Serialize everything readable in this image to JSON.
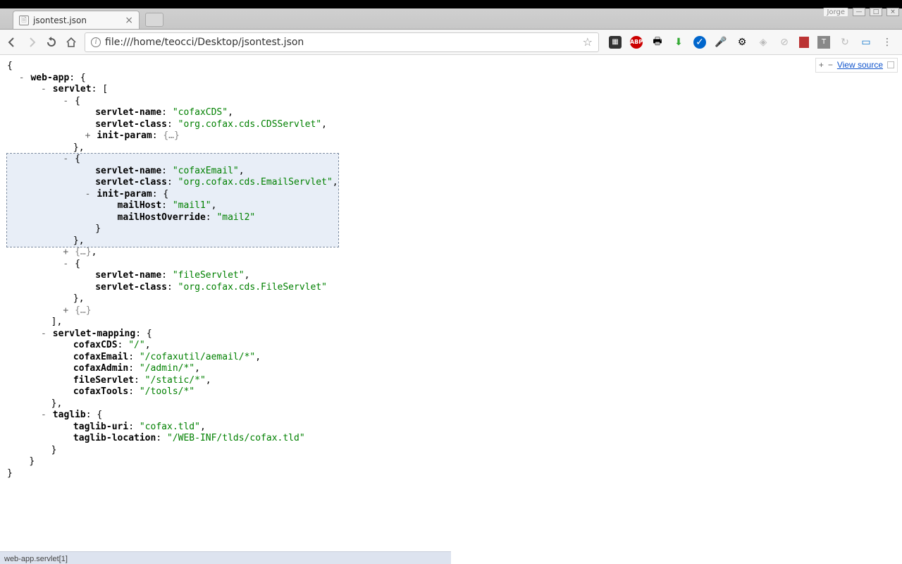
{
  "tab": {
    "title": "jsontest.json"
  },
  "url": "file:///home/teocci/Desktop/jsontest.json",
  "username": "Jorge",
  "viewsource": {
    "plus": "+",
    "minus": "−",
    "label": "View source"
  },
  "statusbar": "web-app.servlet[1]",
  "json": {
    "l1": "{",
    "webapp_key": "web-app",
    "servlet_key": "servlet",
    "s0": {
      "name_k": "servlet-name",
      "name_v": "\"cofaxCDS\"",
      "class_k": "servlet-class",
      "class_v": "\"org.cofax.cds.CDSServlet\"",
      "init_k": "init-param",
      "init_v": "{…}"
    },
    "s1": {
      "name_k": "servlet-name",
      "name_v": "\"cofaxEmail\"",
      "class_k": "servlet-class",
      "class_v": "\"org.cofax.cds.EmailServlet\"",
      "init_k": "init-param",
      "mh_k": "mailHost",
      "mh_v": "\"mail1\"",
      "mho_k": "mailHostOverride",
      "mho_v": "\"mail2\""
    },
    "s2_collapsed": "{…}",
    "s3": {
      "name_k": "servlet-name",
      "name_v": "\"fileServlet\"",
      "class_k": "servlet-class",
      "class_v": "\"org.cofax.cds.FileServlet\""
    },
    "s4_collapsed": "{…}",
    "mapping_key": "servlet-mapping",
    "mapping": {
      "k0": "cofaxCDS",
      "v0": "\"/\"",
      "k1": "cofaxEmail",
      "v1": "\"/cofaxutil/aemail/*\"",
      "k2": "cofaxAdmin",
      "v2": "\"/admin/*\"",
      "k3": "fileServlet",
      "v3": "\"/static/*\"",
      "k4": "cofaxTools",
      "v4": "\"/tools/*\""
    },
    "taglib_key": "taglib",
    "taglib": {
      "uri_k": "taglib-uri",
      "uri_v": "\"cofax.tld\"",
      "loc_k": "taglib-location",
      "loc_v": "\"/WEB-INF/tlds/cofax.tld\""
    }
  }
}
